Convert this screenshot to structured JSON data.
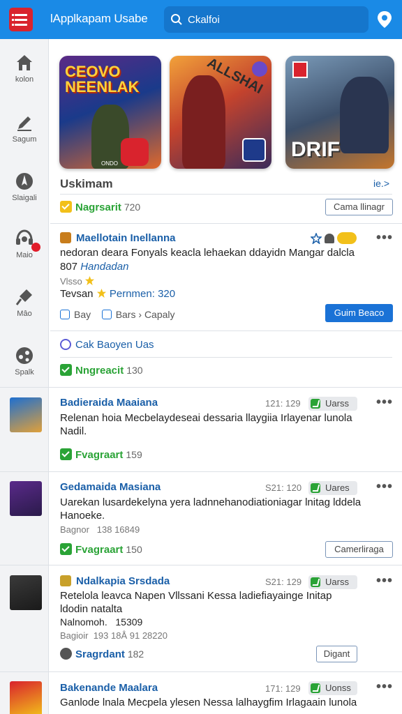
{
  "header": {
    "title": "lApplkapam Usabe",
    "search_placeholder": "Ckalfoi"
  },
  "sidebar": {
    "items": [
      {
        "label": "kolon",
        "icon": "home-icon"
      },
      {
        "label": "Sagum",
        "icon": "pen-icon"
      },
      {
        "label": "Slaigali",
        "icon": "compass-icon"
      },
      {
        "label": "Maio",
        "icon": "headset-icon"
      },
      {
        "label": "Mâo",
        "icon": "microphone-icon"
      },
      {
        "label": "Spalk",
        "icon": "share-icon"
      }
    ]
  },
  "banners": [
    {
      "title": "CEOVO NEENLAK",
      "badge": "ONDO"
    },
    {
      "title": "ALLSHAI"
    },
    {
      "title": "DRIF"
    }
  ],
  "section": {
    "title": "Uskimam",
    "link": "ie.>"
  },
  "top_status": {
    "label": "Nagrsarit",
    "count": "720",
    "button": "Cama llinagr"
  },
  "featured": {
    "title": "Maellotain Inellanna",
    "body_line1": "nedoran deara Fonyals keacla lehaekan ddayidn Mangar dalcla",
    "body_line2_num": "807",
    "body_line2_link": "Handadan",
    "meta": "Vlsso",
    "price_prefix": "Tevsan",
    "price_label": "Pernmen: 320",
    "link1": "Bay",
    "link2": "Bars",
    "link3": "Capaly",
    "button": "Guim Beaco",
    "sub_link": "Cak Baoyen Uas",
    "status_label": "Nngreacit",
    "status_count": "130"
  },
  "items": [
    {
      "title": "Badieraida Maaiana",
      "count": "121: 129",
      "pill": "Uarss",
      "body": "Relenan hoia Mecbelaydeseai dessaria llaygiia Irlayenar lunola Nadil.",
      "status": "Fvagraart",
      "status_count": "159"
    },
    {
      "title": "Gedamaida Masiana",
      "count": "S21: 120",
      "pill": "Uares",
      "body": "Uarekan lusardekelyna yera ladnnehanodiationiagar lnitag lddela Hanoeke.",
      "meta_label": "Bagnor",
      "meta_value": "138 16849",
      "status": "Fvagraart",
      "status_count": "150",
      "button": "Camerliraga"
    },
    {
      "title": "Ndalkapia Srsdada",
      "count": "S21: 129",
      "pill": "Uarss",
      "body": "Retelola leavca Napen Vllssani Kessa ladiefiayainge Initap ldodin natalta",
      "meta_label": "Nalnomoh.",
      "meta_value": "15309",
      "meta2_label": "Bagioir",
      "meta2_value": "193 18Å 91 28220",
      "status": "Sragrdant",
      "status_count": "182",
      "button": "Digant"
    },
    {
      "title": "Bakenande Maalara",
      "count": "171: 129",
      "pill": "Uonss",
      "body": "Ganlode lnala Mecpela ylesen Nessa lalhaygfim Irlagaain lunola"
    }
  ],
  "colors": {
    "header": "#1a8ae6",
    "accent_red": "#d9232d",
    "link_blue": "#1a5fa8",
    "success_green": "#2aa336",
    "button_blue": "#1a72d6"
  }
}
